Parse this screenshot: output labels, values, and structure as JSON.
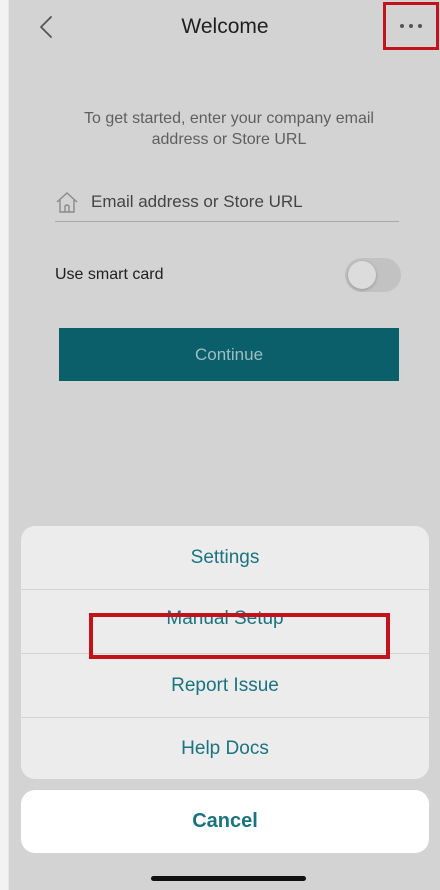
{
  "header": {
    "title": "Welcome"
  },
  "login": {
    "instruction": "To get started, enter your company email address or Store URL",
    "email_placeholder": "Email address or Store URL",
    "smart_card_label": "Use smart card",
    "smart_card_enabled": false,
    "continue_label": "Continue"
  },
  "action_sheet": {
    "items": [
      {
        "label": "Settings"
      },
      {
        "label": "Manual Setup"
      },
      {
        "label": "Report Issue"
      },
      {
        "label": "Help Docs"
      }
    ],
    "cancel_label": "Cancel"
  },
  "icons": {
    "back": "chevron-left-icon",
    "more": "more-horizontal-icon",
    "email": "house-icon"
  },
  "colors": {
    "accent": "#1a7380",
    "continue_bg": "#0b5f6a",
    "highlight": "#c4121c",
    "background": "#d3d3d3"
  }
}
